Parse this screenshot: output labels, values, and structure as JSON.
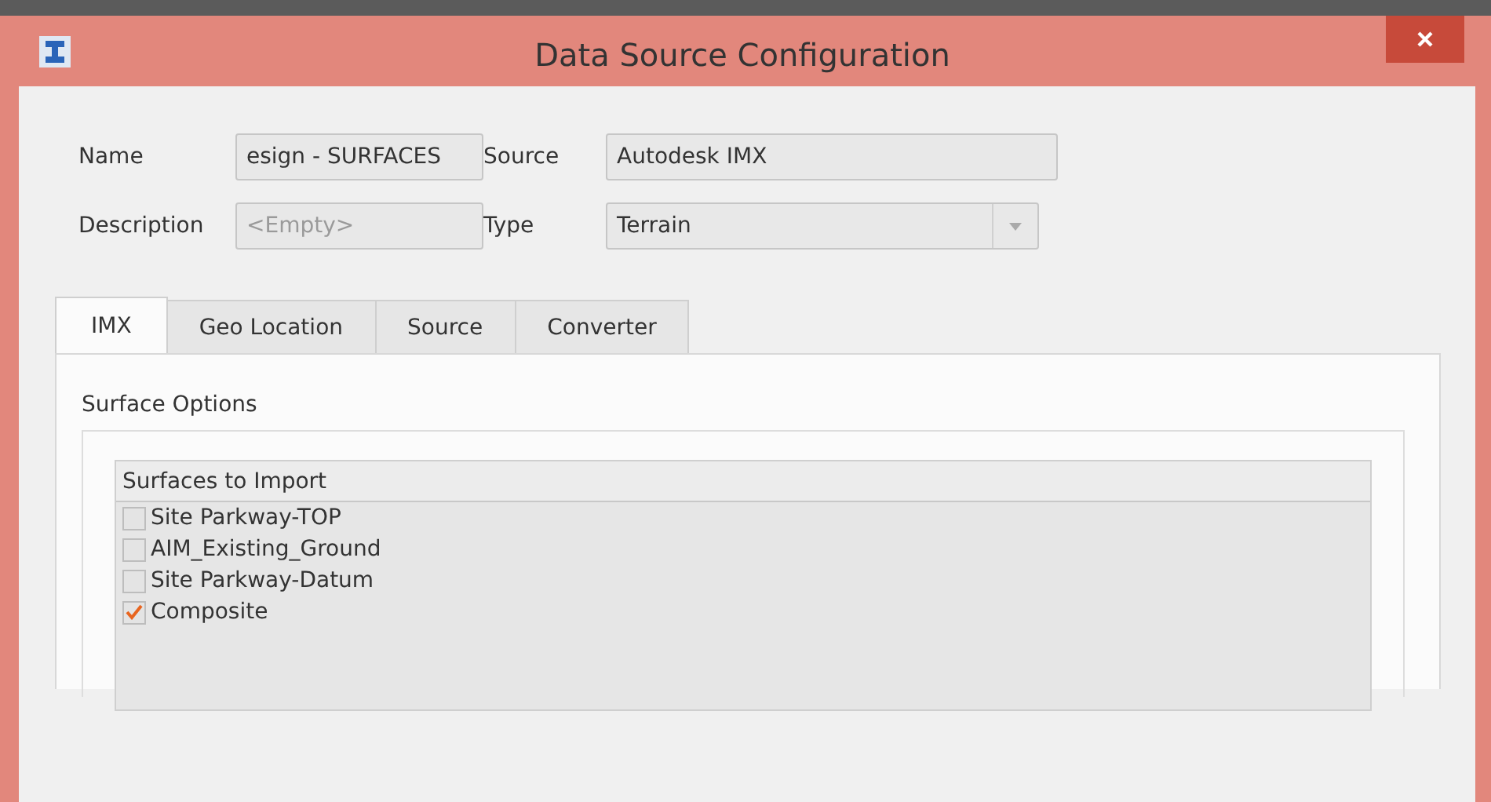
{
  "window": {
    "title": "Data Source Configuration"
  },
  "fields": [
    {
      "kind": "text",
      "label": "Name",
      "value": "esign - SURFACES"
    },
    {
      "kind": "text",
      "label": "Source",
      "value": "Autodesk IMX"
    },
    {
      "kind": "text",
      "label": "Description",
      "placeholder": "<Empty>"
    },
    {
      "kind": "combo",
      "label": "Type",
      "value": "Terrain"
    }
  ],
  "tabs": [
    {
      "label": "IMX",
      "selected": true
    },
    {
      "label": "Geo Location",
      "selected": false
    },
    {
      "label": "Source",
      "selected": false
    },
    {
      "label": "Converter",
      "selected": false
    }
  ],
  "surface_options": {
    "title": "Surface Options",
    "list_header": "Surfaces to Import",
    "items": [
      {
        "label": "Site Parkway-TOP",
        "checked": false
      },
      {
        "label": "AIM_Existing_Ground",
        "checked": false
      },
      {
        "label": "Site Parkway-Datum",
        "checked": false
      },
      {
        "label": "Composite",
        "checked": true
      }
    ]
  }
}
